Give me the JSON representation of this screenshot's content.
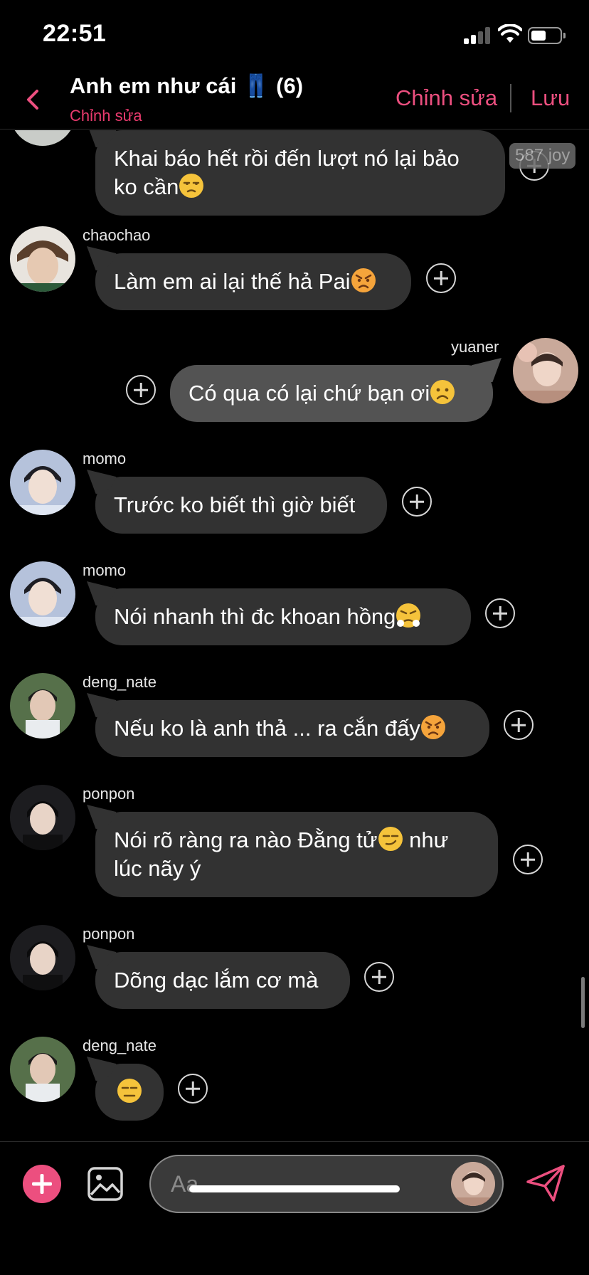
{
  "status_bar": {
    "time": "22:51"
  },
  "header": {
    "title": "Anh em như cái 👖 (6)",
    "subtitle": "Chỉnh sửa",
    "edit_label": "Chỉnh sửa",
    "save_label": "Lưu"
  },
  "messages": [
    {
      "sender": "",
      "text": "Khai báo hết rồi đến lượt nó lại bảo\nko cần",
      "emoji": "unamused",
      "badge": "587 joy",
      "side": "left"
    },
    {
      "sender": "chaochao",
      "text": "Làm em ai lại thế hả Pai",
      "emoji": "angry",
      "side": "left"
    },
    {
      "sender": "yuaner",
      "text": "Có qua có lại chứ bạn ơi",
      "emoji": "frown",
      "side": "right"
    },
    {
      "sender": "momo",
      "text": "Trước ko biết thì giờ biết",
      "side": "left"
    },
    {
      "sender": "momo",
      "text": "Nói nhanh thì đc khoan hồng",
      "emoji": "triumph",
      "side": "left"
    },
    {
      "sender": "deng_nate",
      "text": "Nếu ko là anh thả ... ra cắn đấy",
      "emoji": "angry",
      "side": "left"
    },
    {
      "sender": "ponpon",
      "text": "Nói rõ ràng ra nào Đằng tử",
      "emoji": "smirk",
      "text_after": " như\nlúc nãy ý",
      "side": "left"
    },
    {
      "sender": "ponpon",
      "text": "Dõng dạc lắm cơ mà",
      "side": "left"
    },
    {
      "sender": "deng_nate",
      "text": "",
      "emoji": "expressionless",
      "side": "left"
    }
  ],
  "composer": {
    "placeholder": "Aa"
  },
  "colors": {
    "accent": "#ec4f7f",
    "bubble": "#323232",
    "bubble_self": "#535353",
    "background": "#000000"
  },
  "icons": [
    "back-icon",
    "signal-icon",
    "wifi-icon",
    "battery-icon",
    "add-reaction-icon",
    "plus-icon",
    "image-icon",
    "send-icon"
  ]
}
